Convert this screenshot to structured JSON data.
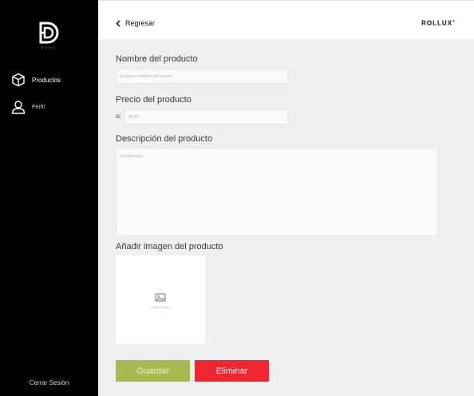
{
  "brand": {
    "logo_subtext": "PERO",
    "name": "ROLLUX",
    "mark": "®"
  },
  "sidebar": {
    "items": [
      {
        "label": "Productos",
        "icon": "box-icon"
      },
      {
        "label": "Perfil",
        "icon": "user-icon"
      }
    ],
    "logout_label": "Cerrar Sesión"
  },
  "header": {
    "back_label": "Regresar"
  },
  "form": {
    "name_label": "Nombre del producto",
    "name_placeholder": "Escriba el nombre del evento...",
    "name_value": "",
    "price_label": "Precio del producto",
    "currency": "S/.",
    "price_placeholder": "00.00",
    "price_value": "",
    "description_label": "Descripción del producto",
    "description_placeholder": "Escribe aqui...",
    "description_value": "",
    "image_label": "Añadir imagen del producto",
    "image_placeholder": "Añadir imagen"
  },
  "actions": {
    "save_label": "Guardar",
    "delete_label": "Eliminar"
  },
  "colors": {
    "sidebar_bg": "#000000",
    "save_button": "#a9b94f",
    "delete_button": "#ef2630",
    "content_bg": "#efefef"
  }
}
